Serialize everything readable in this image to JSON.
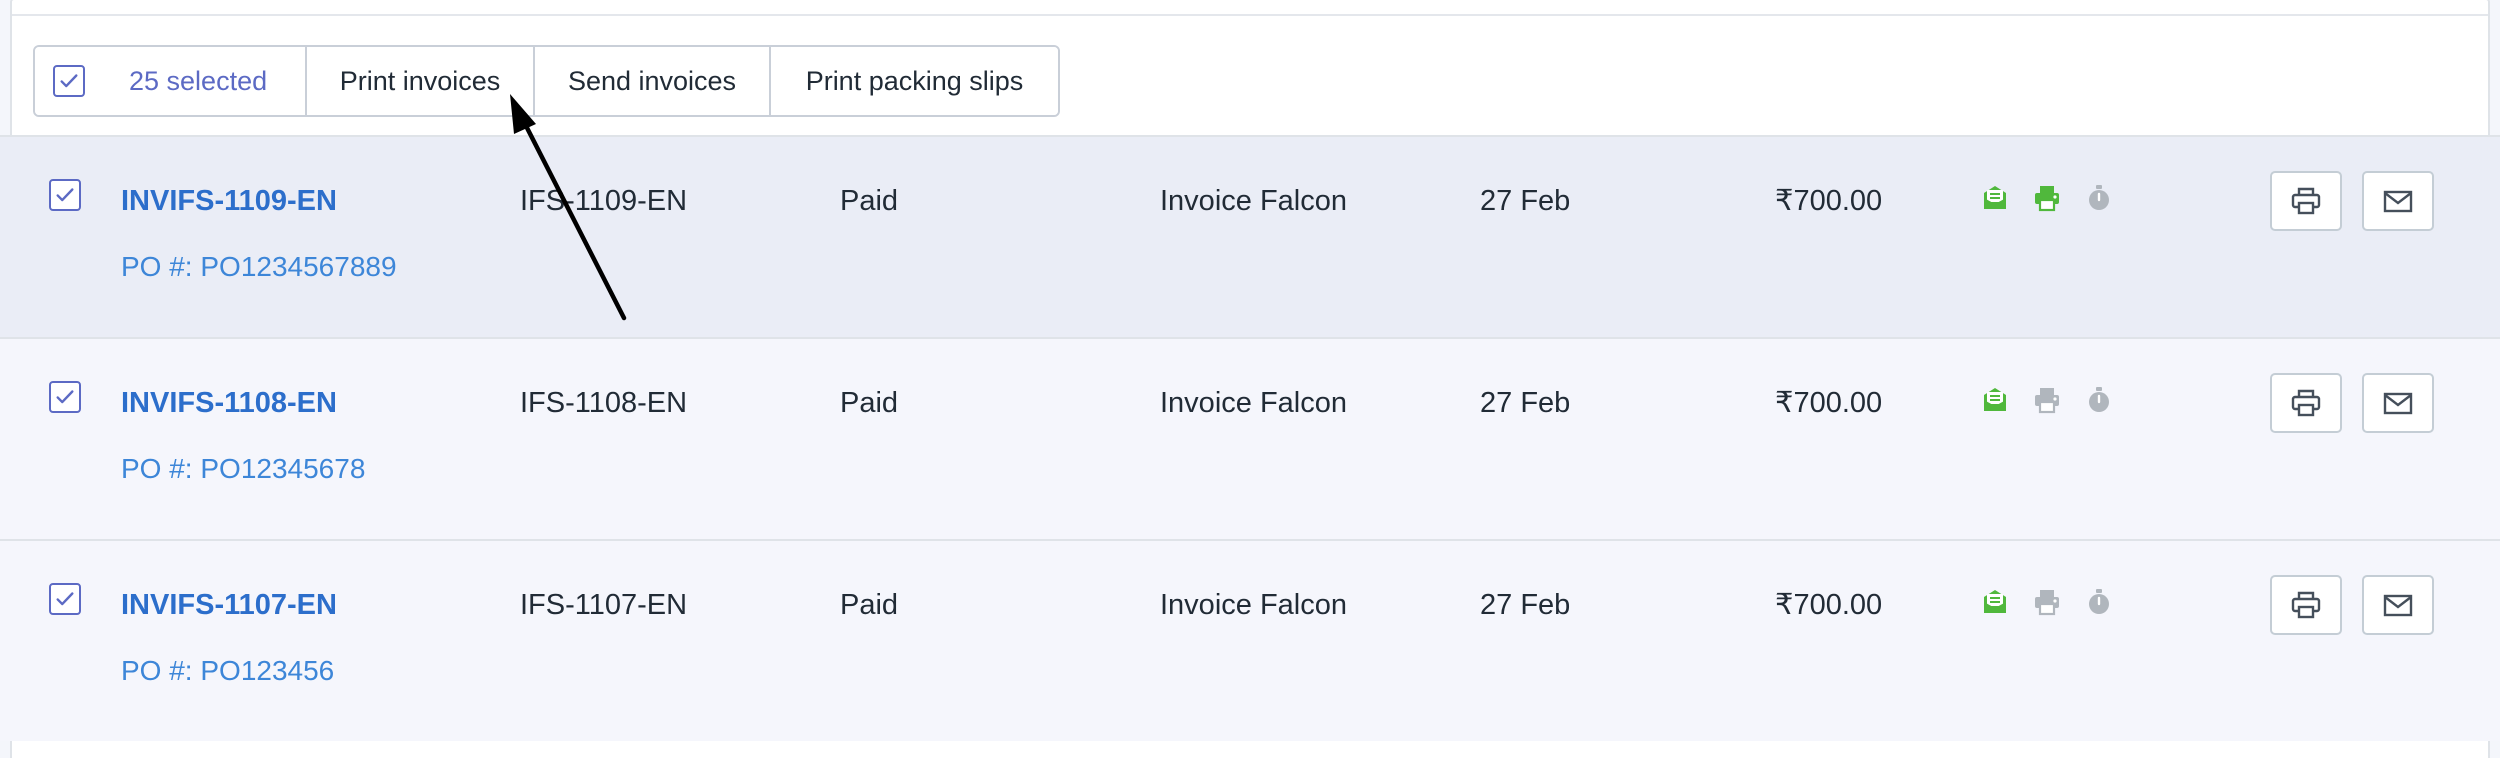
{
  "bulk_actions": {
    "selected_label": "25 selected",
    "print_invoices": "Print invoices",
    "send_invoices": "Send invoices",
    "print_packing_slips": "Print packing slips"
  },
  "invoices": [
    {
      "number": "INVIFS-1109-EN",
      "po": "PO #: PO1234567889",
      "reference": "IFS-1109-EN",
      "status": "Paid",
      "customer": "Invoice Falcon",
      "date": "27 Feb",
      "amount": "₹700.00",
      "printed": true
    },
    {
      "number": "INVIFS-1108-EN",
      "po": "PO #: PO12345678",
      "reference": "IFS-1108-EN",
      "status": "Paid",
      "customer": "Invoice Falcon",
      "date": "27 Feb",
      "amount": "₹700.00",
      "printed": false
    },
    {
      "number": "INVIFS-1107-EN",
      "po": "PO #: PO123456",
      "reference": "IFS-1107-EN",
      "status": "Paid",
      "customer": "Invoice Falcon",
      "date": "27 Feb",
      "amount": "₹700.00",
      "printed": false
    }
  ],
  "colors": {
    "accent": "#5c6ac4",
    "link": "#2c6ecb",
    "success": "#50b83c",
    "muted_icon": "#b0b6bd"
  },
  "icons": {
    "sent": "envelope-open-icon",
    "print": "printer-icon",
    "timer": "stopwatch-icon",
    "mail": "envelope-icon"
  }
}
